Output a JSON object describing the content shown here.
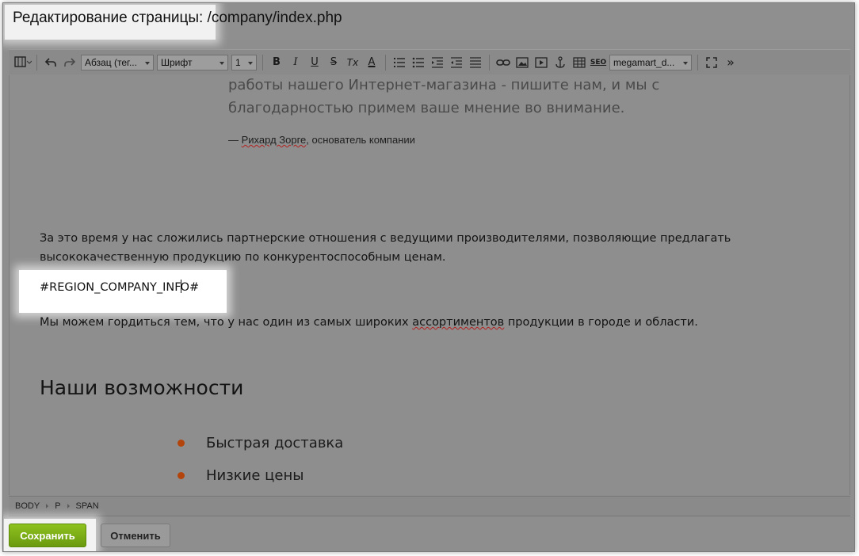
{
  "title": "Редактирование страницы: /company/index.php",
  "toolbar": {
    "paragraph_select": "Абзац (тег...",
    "font_select": "Шрифт",
    "size_select": "1",
    "template_select": "megamart_d...",
    "icons": [
      "view-mode-icon",
      "undo-icon",
      "redo-icon",
      "bold-icon",
      "italic-icon",
      "underline-icon",
      "strikethrough-icon",
      "clear-format-icon",
      "font-color-icon",
      "ordered-list-icon",
      "unordered-list-icon",
      "outdent-icon",
      "indent-icon",
      "align-icon",
      "link-icon",
      "image-icon",
      "video-icon",
      "anchor-icon",
      "table-icon",
      "seo-icon",
      "fullscreen-icon",
      "more-icon"
    ],
    "bold": "B",
    "italic": "I",
    "underline": "U",
    "strike": "S",
    "clear": "Tx",
    "color": "A",
    "seo": "SEO",
    "more": "»"
  },
  "content": {
    "quote": "работы нашего Интернет-магазина - пишите нам, и мы с благодарностью примем ваше мнение во внимание.",
    "quote_author_dash": "— ",
    "quote_author_name": "Рихард Зорге",
    "quote_author_rest": ", основатель компании",
    "para1": "За это время у нас сложились партнерские отношения с ведущими производителями, позволяющие предлагать высококачественную продукцию по конкурентоспособным ценам.",
    "region_before_caret": "#REGION_COMPANY_INF",
    "region_after_caret": "O#",
    "para2_before": "Мы можем гордиться тем, что у нас один из самых широких ",
    "para2_marked": "ассортиментов",
    "para2_after": " продукции в городе и области.",
    "heading": "Наши возможности",
    "list": [
      "Быстрая доставка",
      "Низкие цены"
    ]
  },
  "status_bar": {
    "crumbs": [
      "BODY",
      "P",
      "SPAN"
    ]
  },
  "footer": {
    "save": "Сохранить",
    "cancel": "Отменить"
  },
  "colors": {
    "save_button": "#7fb217",
    "bullet": "#b2440c",
    "overlay": "#8e8e8e"
  }
}
